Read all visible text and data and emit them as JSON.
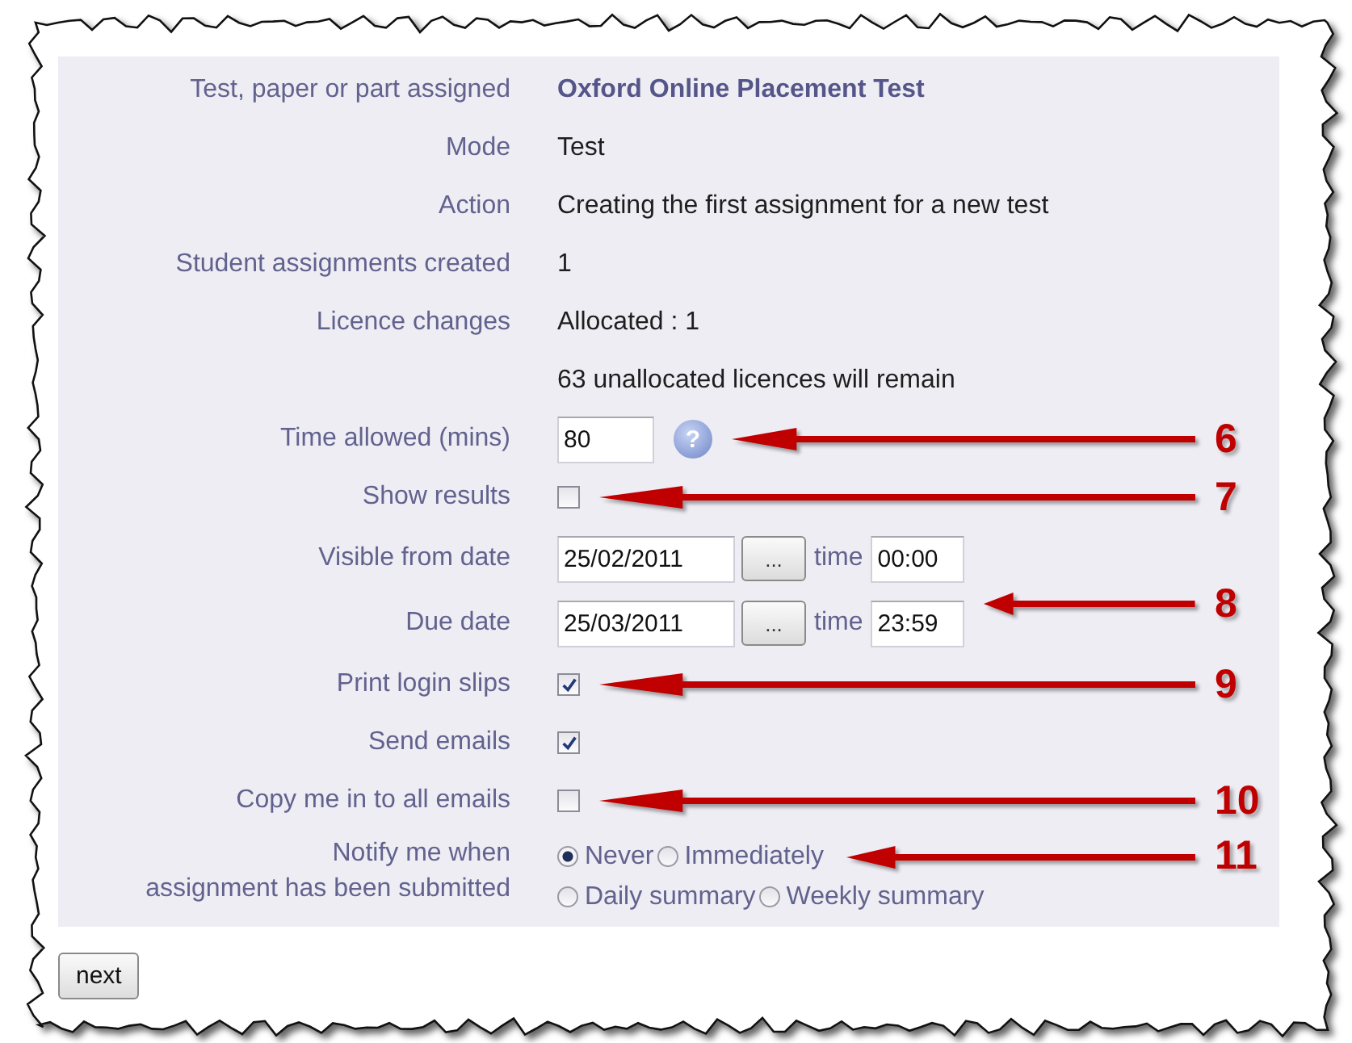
{
  "form": {
    "rows": [
      {
        "kind": "text",
        "label": "Test, paper or part assigned",
        "value": "Oxford Online Placement Test",
        "emphasis": true
      },
      {
        "kind": "text",
        "label": "Mode",
        "value": "Test",
        "emphasis": false
      },
      {
        "kind": "text",
        "label": "Action",
        "value": "Creating the first assignment for a new test",
        "emphasis": false
      },
      {
        "kind": "text",
        "label": "Student assignments created",
        "value": "1",
        "emphasis": false
      },
      {
        "kind": "text",
        "label": "Licence changes",
        "value": "Allocated : 1",
        "emphasis": false
      },
      {
        "kind": "text",
        "value": "63 unallocated licences will remain",
        "emphasis": false
      },
      {
        "kind": "number",
        "label": "Time allowed (mins)",
        "value": "80",
        "help": "?",
        "annotation": "6"
      },
      {
        "kind": "checkbox",
        "label": "Show results",
        "checked": false,
        "annotation": "7"
      },
      {
        "kind": "datetime",
        "label": "Visible from date",
        "date": "25/02/2011",
        "picker": "...",
        "time_label": "time",
        "time": "00:00"
      },
      {
        "kind": "datetime",
        "label": "Due date",
        "date": "25/03/2011",
        "picker": "...",
        "time_label": "time",
        "time": "23:59",
        "annotation": "8"
      },
      {
        "kind": "checkbox",
        "label": "Print login slips",
        "checked": true,
        "annotation": "9"
      },
      {
        "kind": "checkbox",
        "label": "Send emails",
        "checked": true
      },
      {
        "kind": "checkbox",
        "label": "Copy me in to all emails",
        "checked": false,
        "annotation": "10"
      },
      {
        "kind": "radio",
        "label": "Notify me when\nassignment has been submitted",
        "option_rows": [
          [
            {
              "label": "Never",
              "selected": true
            },
            {
              "label": "Immediately",
              "selected": false
            }
          ],
          [
            {
              "label": "Daily summary",
              "selected": false
            },
            {
              "label": "Weekly summary",
              "selected": false
            }
          ]
        ],
        "annotation": "11"
      }
    ]
  },
  "buttons": [
    {
      "label": "next"
    }
  ]
}
